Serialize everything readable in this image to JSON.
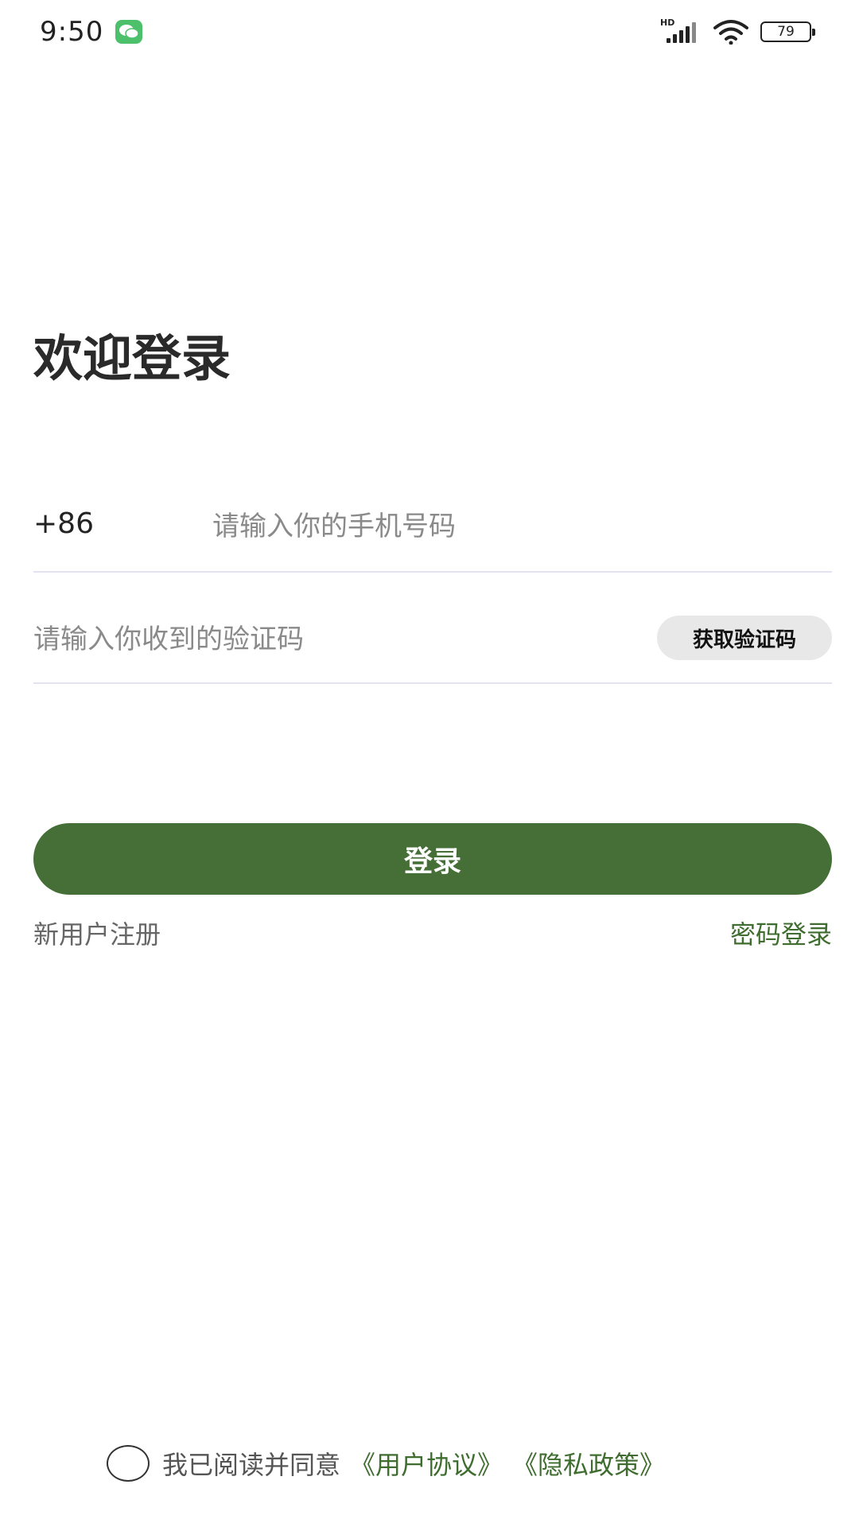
{
  "status_bar": {
    "time": "9:50",
    "signal_label": "HD",
    "battery": "79",
    "icons": [
      "wechat-icon",
      "signal-icon",
      "wifi-icon",
      "battery-icon"
    ]
  },
  "login": {
    "title": "欢迎登录",
    "country_code": "+86",
    "phone_placeholder": "请输入你的手机号码",
    "phone_value": "",
    "code_placeholder": "请输入你收到的验证码",
    "code_value": "",
    "get_code_label": "获取验证码",
    "login_label": "登录",
    "register_label": "新用户注册",
    "password_login_label": "密码登录"
  },
  "agreement": {
    "checked": false,
    "text": "我已阅读并同意",
    "user_agreement": "《用户协议》",
    "privacy_policy": "《隐私政策》"
  },
  "colors": {
    "primary": "#466f37",
    "link": "#3f6d2f",
    "divider": "#e3e3ef",
    "code_button_bg": "#e8e8e8"
  }
}
